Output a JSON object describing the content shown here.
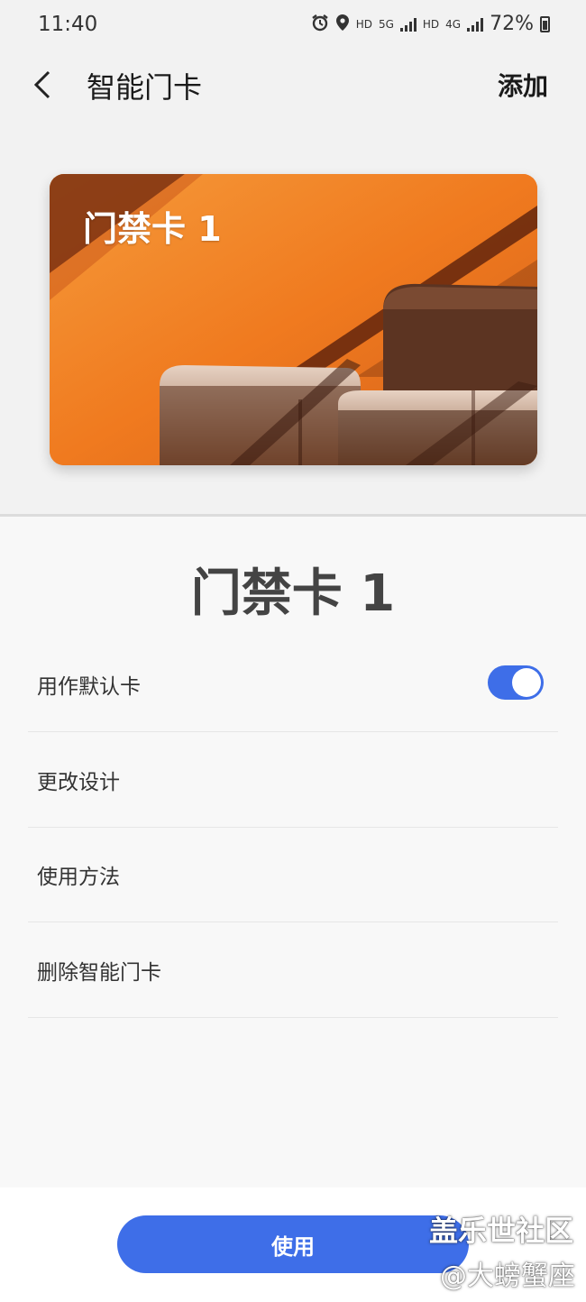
{
  "status_bar": {
    "time": "11:40",
    "hd1": "HD",
    "net1": "5G",
    "hd2": "HD",
    "net2": "4G",
    "battery": "72%",
    "icons": [
      "alarm-icon",
      "location-icon",
      "signal-icon",
      "battery-icon"
    ]
  },
  "app_bar": {
    "title": "智能门卡",
    "add_label": "添加",
    "back_icon": "chevron-left-icon"
  },
  "card": {
    "name": "门禁卡 1",
    "colors": {
      "background": "#f07a1f",
      "shadow": "#6b2a0d"
    }
  },
  "detail": {
    "title": "门禁卡 1"
  },
  "settings": [
    {
      "label": "用作默认卡",
      "toggle": true
    },
    {
      "label": "更改设计"
    },
    {
      "label": "使用方法"
    },
    {
      "label": "删除智能门卡"
    }
  ],
  "default_card_toggle": {
    "on": true,
    "color": "#3e6ee8"
  },
  "bottom": {
    "use_label": "使用"
  },
  "watermark": {
    "line1": "盖乐世社区",
    "line2": "@大螃蟹座"
  }
}
